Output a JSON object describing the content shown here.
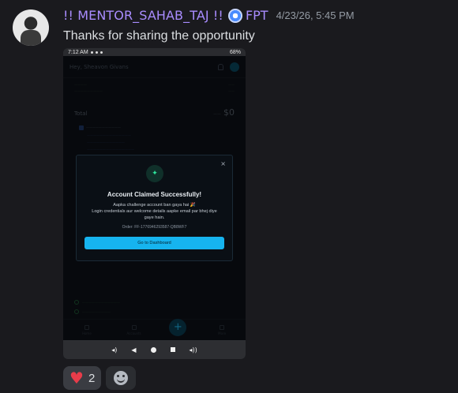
{
  "message": {
    "username": "!! MENTOR_SAHAB_TAJ !!",
    "role_tag": "FPT",
    "timestamp": "4/23/26, 5:45 PM",
    "text": "Thanks for sharing the opportunity"
  },
  "phone": {
    "status_time": "7:12 AM",
    "battery": "68%",
    "greeting": "Hey, Sheavon Givans",
    "total_label": "Total",
    "total_value": "$0",
    "modal": {
      "close": "×",
      "title": "Account Claimed Successfully!",
      "body_line1": "Aapka challenge account ban gaya hai 🎉",
      "body_line2": "Login credentials aur welcome details aapke email par bhej diye gaye hain.",
      "order": "Order: FF-1776946293587-QB8WF7",
      "button": "Go to Dashboard"
    },
    "nav": [
      "Home",
      "Accounts",
      "More"
    ]
  },
  "reactions": [
    {
      "emoji": "heart-icon",
      "count": "2"
    }
  ],
  "colors": {
    "username": "#a98cff",
    "accent_button": "#16b4ef",
    "heart": "#e83c4a"
  }
}
